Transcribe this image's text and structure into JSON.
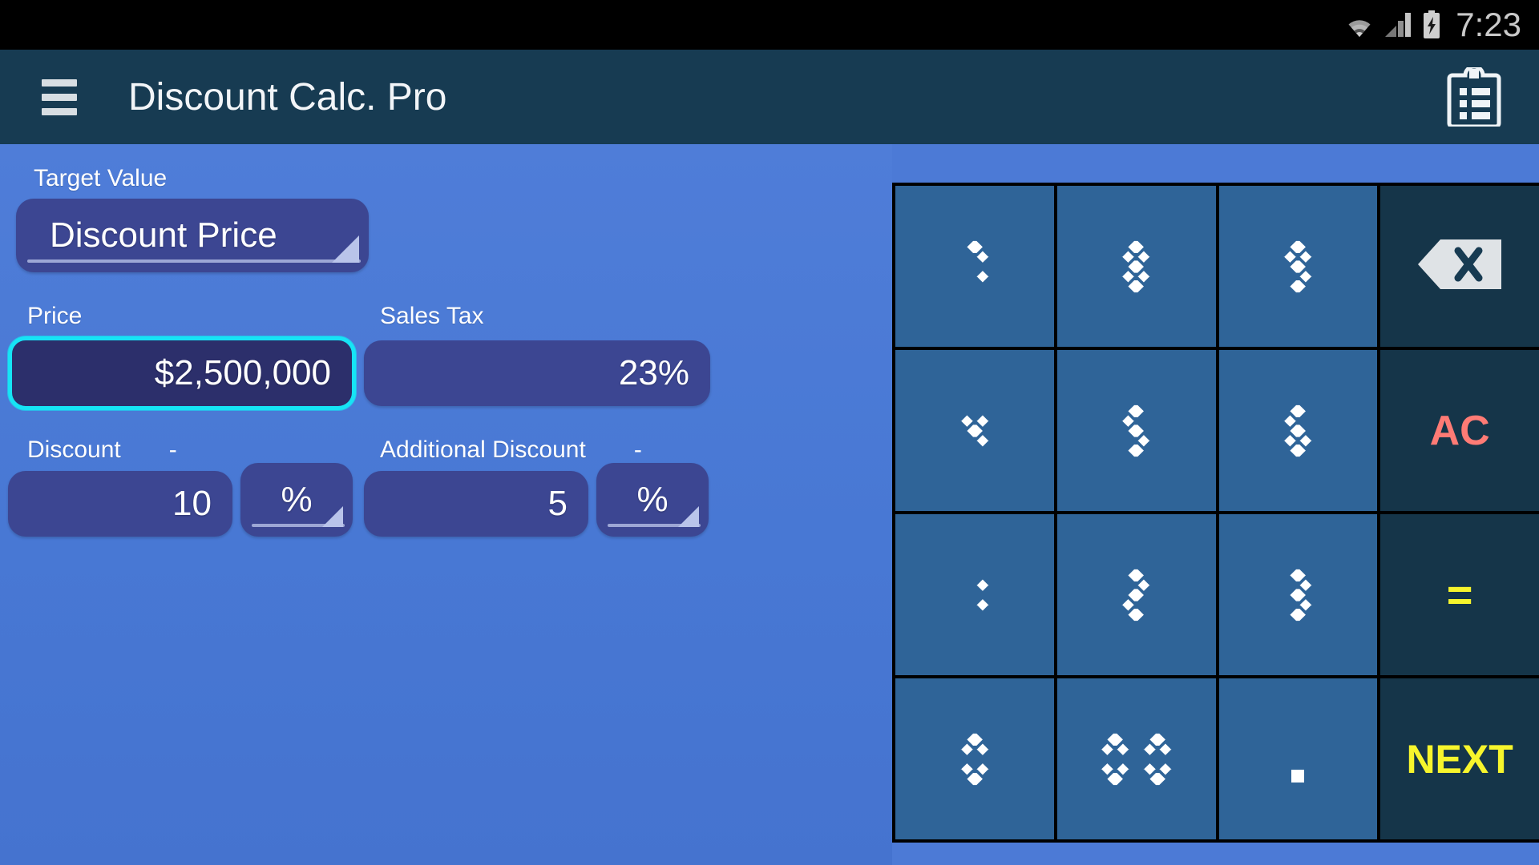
{
  "statusbar": {
    "time": "7:23",
    "icons": [
      "wifi-icon",
      "cellular-signal-icon",
      "battery-charging-icon"
    ]
  },
  "appbar": {
    "menu_icon": "hamburger-menu-icon",
    "title": "Discount Calc. Pro",
    "action_icon": "clipboard-list-icon"
  },
  "form": {
    "target": {
      "label": "Target Value",
      "value": "Discount Price"
    },
    "price": {
      "label": "Price",
      "value": "$2,500,000",
      "focused": true
    },
    "sales_tax": {
      "label": "Sales Tax",
      "value": "23%"
    },
    "discount": {
      "label": "Discount",
      "sign": "-",
      "value": "10",
      "unit": "%"
    },
    "additional_discount": {
      "label": "Additional Discount",
      "sign": "-",
      "value": "5",
      "unit": "%"
    }
  },
  "keypad": {
    "keys": [
      {
        "name": "key-7",
        "label": "7",
        "style": "seg"
      },
      {
        "name": "key-8",
        "label": "8",
        "style": "seg"
      },
      {
        "name": "key-9",
        "label": "9",
        "style": "seg"
      },
      {
        "name": "key-backspace",
        "label": "",
        "style": "func-icon"
      },
      {
        "name": "key-4",
        "label": "4",
        "style": "seg"
      },
      {
        "name": "key-5",
        "label": "5",
        "style": "seg"
      },
      {
        "name": "key-6",
        "label": "6",
        "style": "seg"
      },
      {
        "name": "key-ac",
        "label": "AC",
        "style": "func-ac"
      },
      {
        "name": "key-1",
        "label": "1",
        "style": "seg"
      },
      {
        "name": "key-2",
        "label": "2",
        "style": "seg"
      },
      {
        "name": "key-3",
        "label": "3",
        "style": "seg"
      },
      {
        "name": "key-equals",
        "label": "=",
        "style": "func-eq"
      },
      {
        "name": "key-0",
        "label": "0",
        "style": "seg"
      },
      {
        "name": "key-double-0",
        "label": "00",
        "style": "seg"
      },
      {
        "name": "key-decimal",
        "label": ".",
        "style": "seg"
      },
      {
        "name": "key-next",
        "label": "NEXT",
        "style": "func-next"
      }
    ]
  },
  "colors": {
    "appbar": "#173b52",
    "background": "#4c7ad6",
    "input": "#3c4692",
    "input_focused": "#2c2f6b",
    "focus_ring": "#16e4f5",
    "key": "#2f6498",
    "key_func": "#153549",
    "ac": "#ff7b75",
    "yellow": "#f7f52c"
  }
}
